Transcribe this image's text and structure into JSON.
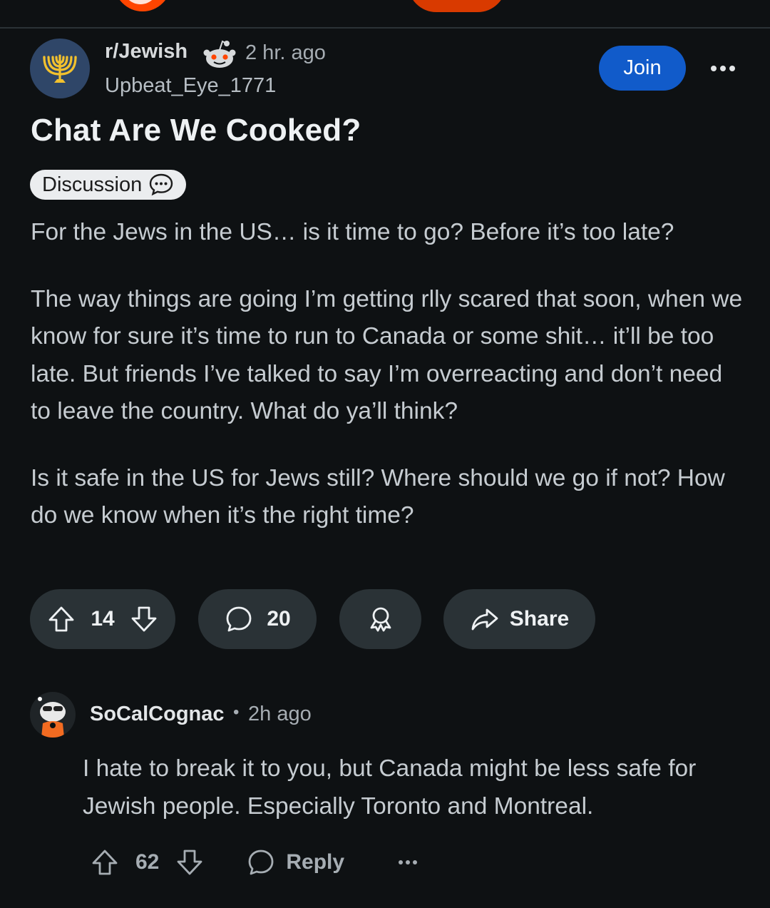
{
  "post": {
    "subreddit": "r/Jewish",
    "time_ago": "2 hr. ago",
    "author": "Upbeat_Eye_1771",
    "join_label": "Join",
    "title": "Chat Are We Cooked?",
    "flair": "Discussion",
    "body": [
      "For the Jews in the US… is it time to go? Before it’s too late?",
      "The way things are going I’m getting rlly scared that soon, when we know for sure it’s time to run to Canada or some shit… it’ll be too late. But friends I’ve talked to say I’m overreacting and don’t need to leave the country. What do ya’ll think?",
      "Is it safe in the US for Jews still? Where should we go if not? How do we know when it’s the right time?"
    ],
    "score": "14",
    "comments": "20",
    "share_label": "Share",
    "icons": [
      "menorah-icon",
      "snoo-icon",
      "more-icon",
      "speech-bubble-icon",
      "upvote-icon",
      "downvote-icon",
      "comment-icon",
      "award-icon",
      "share-icon"
    ]
  },
  "comment": {
    "author": "SoCalCognac",
    "separator": "•",
    "time_ago": "2h ago",
    "text": "I hate to break it to you, but Canada might be less safe for Jewish people. Especially Toronto and Montreal.",
    "score": "62",
    "reply_label": "Reply"
  },
  "colors": {
    "background": "#0e1113",
    "join_button": "#115bca",
    "pill_background": "#2a3236",
    "subreddit_avatar": "#2f4668",
    "menorah": "#f2c12e",
    "brand_orange": "#ff4500"
  }
}
